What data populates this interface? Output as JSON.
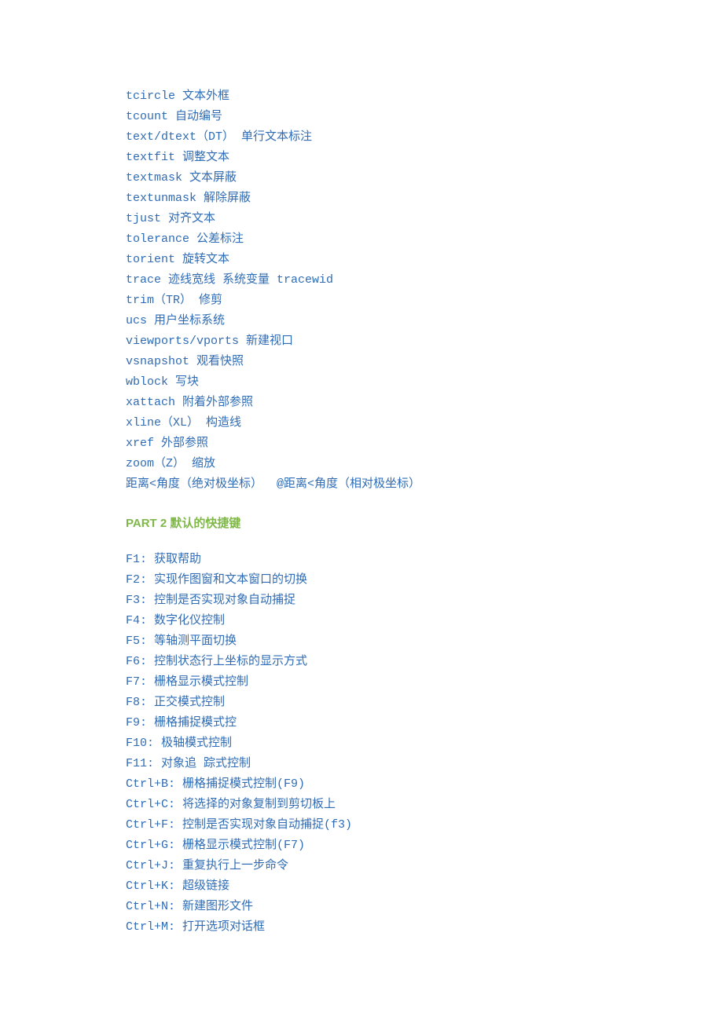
{
  "commands": [
    "tcircle 文本外框",
    "tcount 自动编号",
    "text/dtext（DT） 单行文本标注",
    "textfit 调整文本",
    "textmask 文本屏蔽",
    "textunmask 解除屏蔽",
    "tjust 对齐文本",
    "tolerance 公差标注",
    "torient 旋转文本",
    "trace 迹线宽线 系统变量 tracewid",
    "trim（TR） 修剪",
    "ucs 用户坐标系统",
    "viewports/vports 新建视口",
    "vsnapshot 观看快照",
    "wblock 写块",
    "xattach 附着外部参照",
    "xline（XL） 构造线",
    "xref 外部参照",
    "zoom（Z） 缩放",
    "距离<角度（绝对极坐标）  @距离<角度（相对极坐标）"
  ],
  "section2_title": "PART 2  默认的快捷键",
  "shortcuts": [
    "F1: 获取帮助",
    "F2: 实现作图窗和文本窗口的切换",
    "F3: 控制是否实现对象自动捕捉",
    "F4: 数字化仪控制",
    "F5: 等轴测平面切换",
    "F6: 控制状态行上坐标的显示方式",
    "F7: 栅格显示模式控制",
    "F8: 正交模式控制",
    "F9: 栅格捕捉模式控",
    "F10: 极轴模式控制",
    "F11: 对象追 踪式控制",
    "Ctrl+B: 栅格捕捉模式控制(F9)",
    "Ctrl+C: 将选择的对象复制到剪切板上",
    "Ctrl+F: 控制是否实现对象自动捕捉(f3)",
    "Ctrl+G: 栅格显示模式控制(F7)",
    "Ctrl+J: 重复执行上一步命令",
    "Ctrl+K: 超级链接",
    "Ctrl+N: 新建图形文件",
    "Ctrl+M: 打开选项对话框"
  ]
}
